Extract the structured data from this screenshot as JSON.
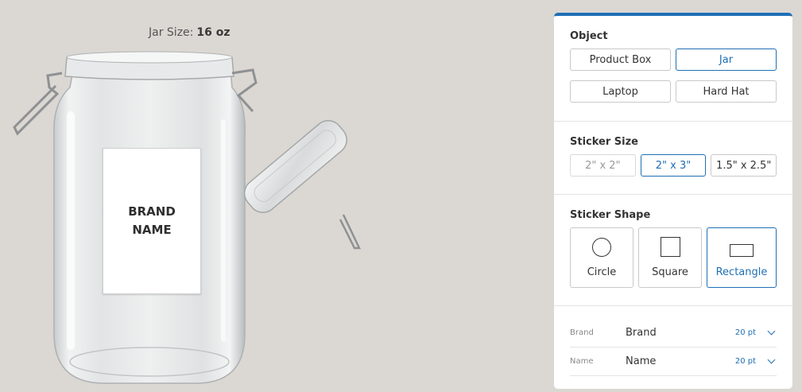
{
  "stage": {
    "jar_size_label": "Jar Size:",
    "jar_size_value": "16 oz",
    "sticker_text_line1": "BRAND",
    "sticker_text_line2": "NAME"
  },
  "panel": {
    "accent_color": "#1f6fb5",
    "object": {
      "title": "Object",
      "options": [
        "Product Box",
        "Jar",
        "Laptop",
        "Hard Hat"
      ],
      "selected": "Jar"
    },
    "sticker_size": {
      "title": "Sticker Size",
      "options": [
        "2\" x 2\"",
        "2\" x 3\"",
        "1.5\" x 2.5\""
      ],
      "selected": "2\" x 3\"",
      "disabled": "2\" x 2\""
    },
    "sticker_shape": {
      "title": "Sticker Shape",
      "options": [
        {
          "label": "Circle",
          "icon": "circle-icon"
        },
        {
          "label": "Square",
          "icon": "square-icon"
        },
        {
          "label": "Rectangle",
          "icon": "rectangle-icon"
        }
      ],
      "selected": "Rectangle"
    },
    "text_fields": [
      {
        "label": "Brand",
        "value": "Brand",
        "size": "20 pt"
      },
      {
        "label": "Name",
        "value": "Name",
        "size": "20 pt"
      }
    ]
  }
}
